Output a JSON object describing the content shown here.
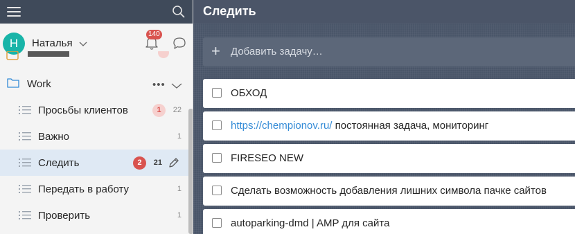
{
  "sidebar": {
    "user": {
      "avatar_letter": "H",
      "name": "Наталья"
    },
    "notifications_count": "140",
    "folder": {
      "name": "Work",
      "more": "•••"
    },
    "items": [
      {
        "label": "Просьбы клиентов",
        "badge": "1",
        "count": "22"
      },
      {
        "label": "Важно",
        "count": "1"
      },
      {
        "label": "Следить",
        "badge": "2",
        "count": "21",
        "active": true
      },
      {
        "label": "Передать в работу",
        "count": "1"
      },
      {
        "label": "Проверить",
        "count": "1"
      }
    ]
  },
  "main": {
    "title": "Следить",
    "add_task_placeholder": "Добавить задачу…",
    "tasks": [
      {
        "text": "ОБХОД"
      },
      {
        "link": "https://chempionov.ru/",
        "text": " постоянная задача, мониторинг"
      },
      {
        "text": "FIRESEO NEW"
      },
      {
        "text": "Сделать возможность добавления лишних символа пачке сайтов"
      },
      {
        "text": "autoparking-dmd | AMP для сайта"
      }
    ]
  },
  "colors": {
    "accent_teal": "#18b4a8",
    "badge_red": "#d9534f",
    "header_bg": "#3f4a5a",
    "main_bg": "#4a5669",
    "link_blue": "#328ad6"
  }
}
